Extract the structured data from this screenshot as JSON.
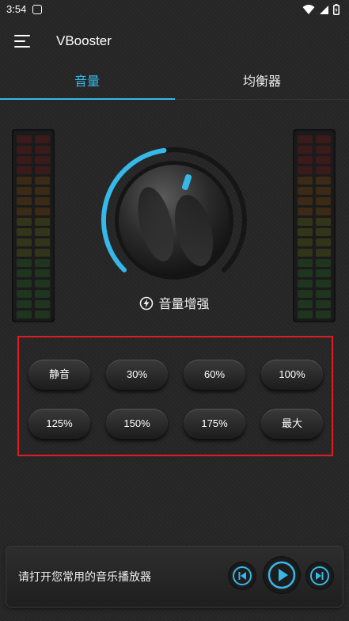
{
  "status": {
    "time": "3:54"
  },
  "app": {
    "title": "VBooster"
  },
  "tabs": [
    {
      "label": "音量"
    },
    {
      "label": "均衡器"
    }
  ],
  "knob": {
    "label": "音量增强",
    "level_fraction": 0.47
  },
  "presets": [
    {
      "label": "静音"
    },
    {
      "label": "30%"
    },
    {
      "label": "60%"
    },
    {
      "label": "100%"
    },
    {
      "label": "125%"
    },
    {
      "label": "150%"
    },
    {
      "label": "175%"
    },
    {
      "label": "最大"
    }
  ],
  "player": {
    "prompt": "请打开您常用的音乐播放器"
  },
  "colors": {
    "accent": "#36b8e8",
    "highlight_border": "#e01b24"
  },
  "icons": [
    "menu-icon",
    "bolt-icon",
    "previous-icon",
    "play-icon",
    "next-icon",
    "wifi-icon",
    "signal-icon",
    "battery-icon"
  ]
}
